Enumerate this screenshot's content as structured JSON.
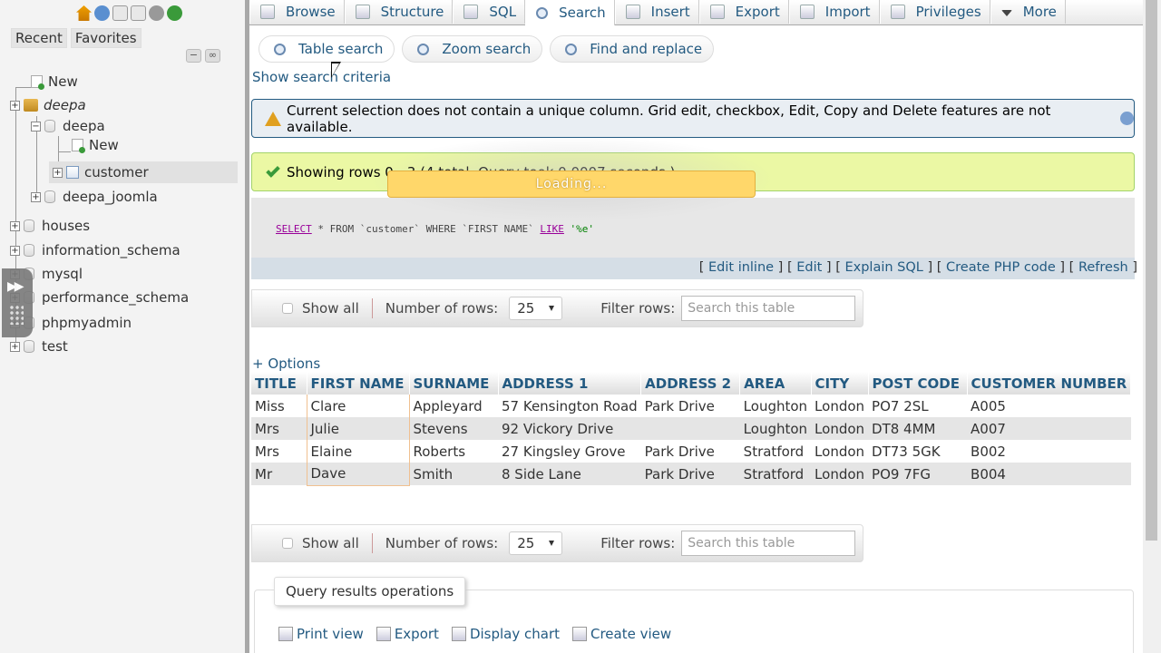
{
  "sidebar": {
    "tabs": [
      "Recent",
      "Favorites"
    ],
    "tree": {
      "new_root": "New",
      "db_group": "deepa",
      "db": "deepa",
      "new_table": "New",
      "table": "customer",
      "db2": "deepa_joomla",
      "others": [
        "houses",
        "information_schema",
        "mysql",
        "performance_schema",
        "phpmyadmin",
        "test"
      ]
    }
  },
  "menu": {
    "tabs": [
      "Browse",
      "Structure",
      "SQL",
      "Search",
      "Insert",
      "Export",
      "Import",
      "Privileges",
      "More"
    ],
    "active": "Search"
  },
  "subtabs": [
    "Table search",
    "Zoom search",
    "Find and replace"
  ],
  "show_criteria": "Show search criteria",
  "notice": "Current selection does not contain a unique column. Grid edit, checkbox, Edit, Copy and Delete features are not available.",
  "success": "Showing rows 0 - 3 (4 total, Query took 0.0007 seconds.)",
  "loading": "Loading...",
  "sql": {
    "select": "SELECT",
    "rest1": " * FROM `customer` WHERE `FIRST NAME` ",
    "like": "LIKE",
    "value": " '%e'"
  },
  "sql_links": [
    "Edit inline",
    "Edit",
    "Explain SQL",
    "Create PHP code",
    "Refresh"
  ],
  "nav": {
    "show_all": "Show all",
    "num_rows_label": "Number of rows:",
    "num_rows_value": "25",
    "filter_label": "Filter rows:",
    "filter_placeholder": "Search this table"
  },
  "options_link": "+ Options",
  "table": {
    "headers": [
      "TITLE",
      "FIRST NAME",
      "SURNAME",
      "ADDRESS 1",
      "ADDRESS 2",
      "AREA",
      "CITY",
      "POST CODE",
      "CUSTOMER NUMBER"
    ],
    "rows": [
      [
        "Miss",
        "Clare",
        "Appleyard",
        "57 Kensington Road",
        "Park Drive",
        "Loughton",
        "London",
        "PO7 2SL",
        "A005"
      ],
      [
        "Mrs",
        "Julie",
        "Stevens",
        "92 Vickory Drive",
        "",
        "Loughton",
        "London",
        "DT8 4MM",
        "A007"
      ],
      [
        "Mrs",
        "Elaine",
        "Roberts",
        "27 Kingsley Grove",
        "Park Drive",
        "Stratford",
        "London",
        "DT73 5GK",
        "B002"
      ],
      [
        "Mr",
        "Dave",
        "Smith",
        "8 Side Lane",
        "Park Drive",
        "Stratford",
        "London",
        "PO9 7FG",
        "B004"
      ]
    ]
  },
  "qro": {
    "legend": "Query results operations",
    "links": [
      "Print view",
      "Export",
      "Display chart",
      "Create view"
    ]
  }
}
